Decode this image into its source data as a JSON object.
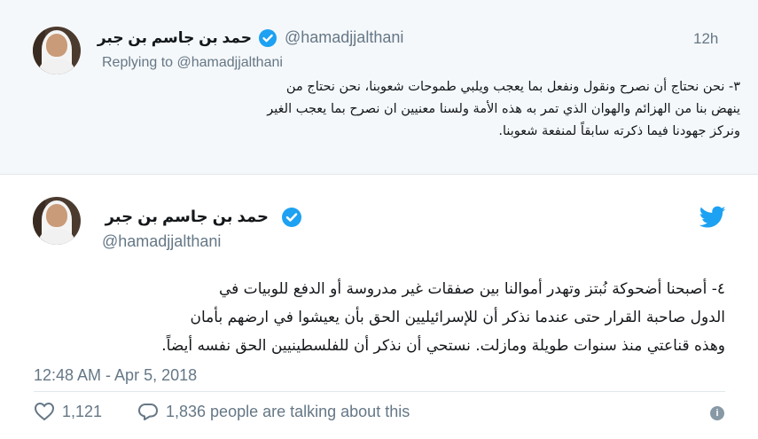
{
  "reply_tweet": {
    "author_name": "حمد بن جاسم بن جبر",
    "handle": "@hamadjjalthani",
    "time": "12h",
    "replying_to_prefix": "Replying to ",
    "replying_to_handle": "@hamadjjalthani",
    "text_lines": [
      "٣- نحن نحتاج أن نصرح ونقول ونفعل بما يعجب ويلبي طموحات شعوبنا، نحن نحتاج من",
      "ينهض بنا من الهزائم والهوان الذي تمر به هذه الأمة ولسنا معنيين ان نصرح بما يعجب الغير",
      "ونركز جهودنا فيما ذكرته سابقاً لمنفعة شعوبنا."
    ]
  },
  "main_tweet": {
    "author_name": "حمد بن جاسم بن جبر",
    "handle": "@hamadjjalthani",
    "text_lines": [
      "٤- أصبحنا أضحوكة نُبتز وتهدر أموالنا بين صفقات غير مدروسة أو الدفع للوبيات في",
      "الدول صاحبة القرار حتى عندما نذكر أن للإسرائيليين الحق بأن يعيشوا في ارضهم بأمان",
      "وهذه قناعتي منذ سنوات طويلة ومازلت. نستحي أن نذكر أن للفلسطينيين الحق نفسه أيضاً."
    ],
    "timestamp": "12:48 AM - Apr 5, 2018",
    "likes": "1,121",
    "talking": "1,836 people are talking about this"
  },
  "colors": {
    "accent": "#1da1f2",
    "muted": "#657786",
    "reply_bg": "#f5f8fa",
    "divider": "#e1e8ed"
  },
  "icons": {
    "verified": "verified-badge-icon",
    "bird": "twitter-bird-icon",
    "like": "heart-icon",
    "reply": "speech-bubble-icon",
    "info": "info-icon"
  }
}
